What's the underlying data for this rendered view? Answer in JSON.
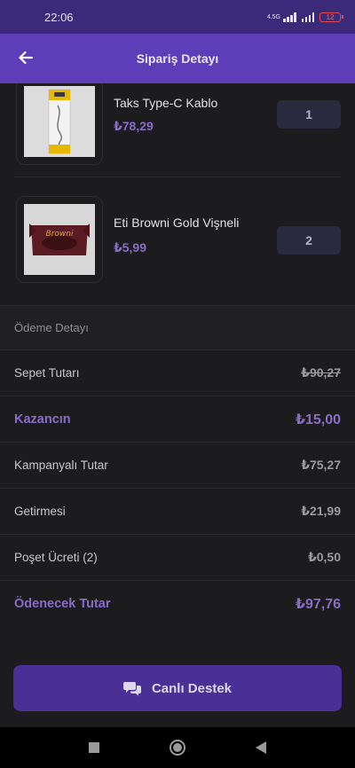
{
  "status_bar": {
    "time": "22:06",
    "network": "4.5G",
    "battery": "12"
  },
  "header": {
    "title": "Sipariş Detayı"
  },
  "products": [
    {
      "name": "Taks Type-C Kablo",
      "price": "₺78,29",
      "quantity": "1"
    },
    {
      "name": "Eti Browni Gold Vişneli",
      "price": "₺5,99",
      "quantity": "2"
    }
  ],
  "product_images": {
    "brownie_label": "Browni"
  },
  "payment": {
    "title": "Ödeme Detayı",
    "rows": [
      {
        "label": "Sepet Tutarı",
        "value": "₺90,27"
      },
      {
        "label": "Kazancın",
        "value": "₺15,00"
      },
      {
        "label": "Kampanyalı Tutar",
        "value": "₺75,27"
      },
      {
        "label": "Getirmesi",
        "value": "₺21,99"
      },
      {
        "label": "Poşet Ücreti (2)",
        "value": "₺0,50"
      },
      {
        "label": "Ödenecek Tutar",
        "value": "₺97,76"
      }
    ]
  },
  "support": {
    "label": "Canlı Destek"
  },
  "colors": {
    "accent": "#5d3eb8",
    "accent_text": "#8a6bc8",
    "background": "#1c1c1e"
  }
}
